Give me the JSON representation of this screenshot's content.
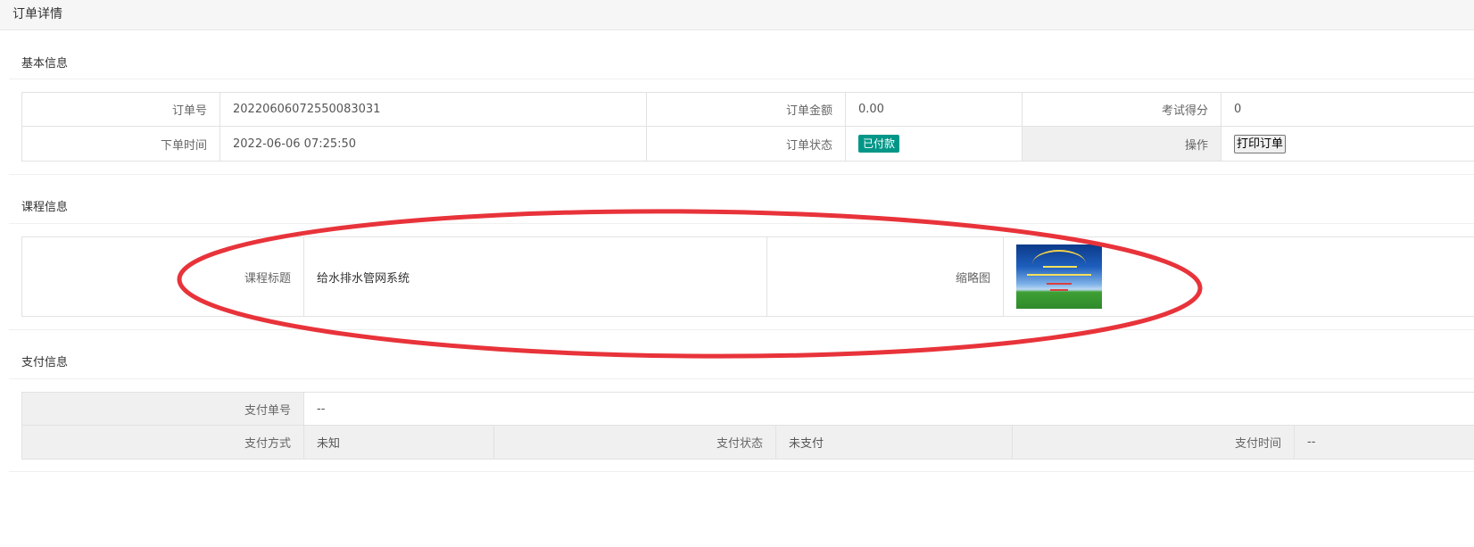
{
  "page": {
    "title": "订单详情"
  },
  "basic_info": {
    "title": "基本信息",
    "order_no_label": "订单号",
    "order_no": "20220606072550083031",
    "amount_label": "订单金额",
    "amount": "0.00",
    "score_label": "考试得分",
    "score": "0",
    "order_time_label": "下单时间",
    "order_time": "2022-06-06 07:25:50",
    "status_label": "订单状态",
    "status": "已付款",
    "action_label": "操作",
    "print_button": "打印订单"
  },
  "course_info": {
    "title": "课程信息",
    "course_title_label": "课程标题",
    "course_title": "给水排水管网系统",
    "thumbnail_label": "缩略图"
  },
  "payment_info": {
    "title": "支付信息",
    "pay_no_label": "支付单号",
    "pay_no": "--",
    "pay_method_label": "支付方式",
    "pay_method": "未知",
    "pay_status_label": "支付状态",
    "pay_status": "未支付",
    "pay_time_label": "支付时间",
    "pay_time": "--"
  },
  "colors": {
    "badge": "#009688",
    "annotation": "#e8333a",
    "shade": "#f0f0f0"
  }
}
